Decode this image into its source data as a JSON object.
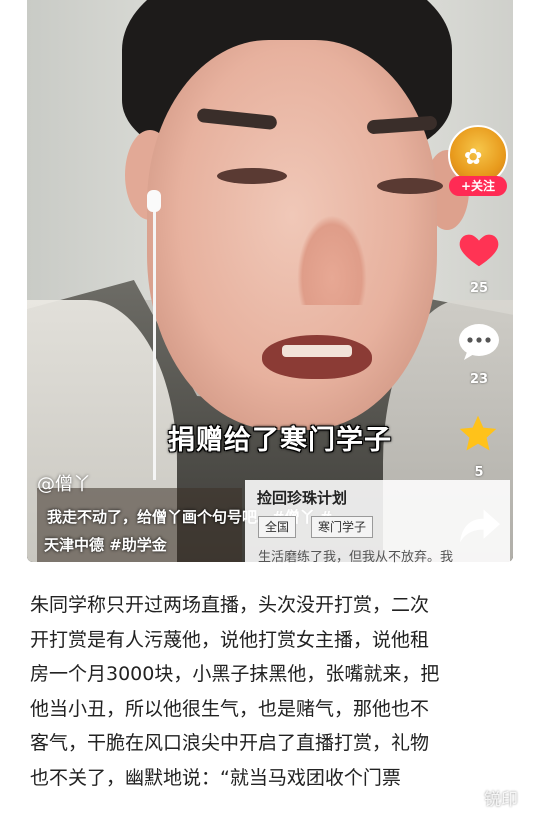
{
  "video": {
    "caption": "捐赠给了寒门学子",
    "author": "@僧丫",
    "description_line1": "我走不动了，给僧丫画个句号吧。#僧丫 #",
    "description_line2": "天津中德 #助学金",
    "follow_label": "+关注",
    "likes": "25",
    "comments": "23",
    "favorites": "5",
    "card": {
      "title": "捡回珍珠计划",
      "chips": [
        "全国",
        "寒门学子"
      ],
      "subtitle": "生活磨练了我，但我从不放弃。我"
    },
    "colors": {
      "accent": "#ff2b54",
      "heart": "#ff3354",
      "star": "#ffc21a"
    },
    "icons": [
      "heart-icon",
      "comment-icon",
      "star-icon",
      "share-icon"
    ]
  },
  "article": {
    "lines": [
      "朱同学称只开过两场直播，头次没开打赏，二次",
      "开打赏是有人污蔑他，说他打赏女主播，说他租",
      "房一个月3000块，小黑子抹黑他，张嘴就来，把",
      "他当小丑，所以他很生气，也是赌气，那他也不",
      "客气，干脆在风口浪尖中开启了直播打赏，礼物",
      "也不关了，幽默地说：“就当马戏团收个门票"
    ]
  },
  "watermark": "锐印"
}
